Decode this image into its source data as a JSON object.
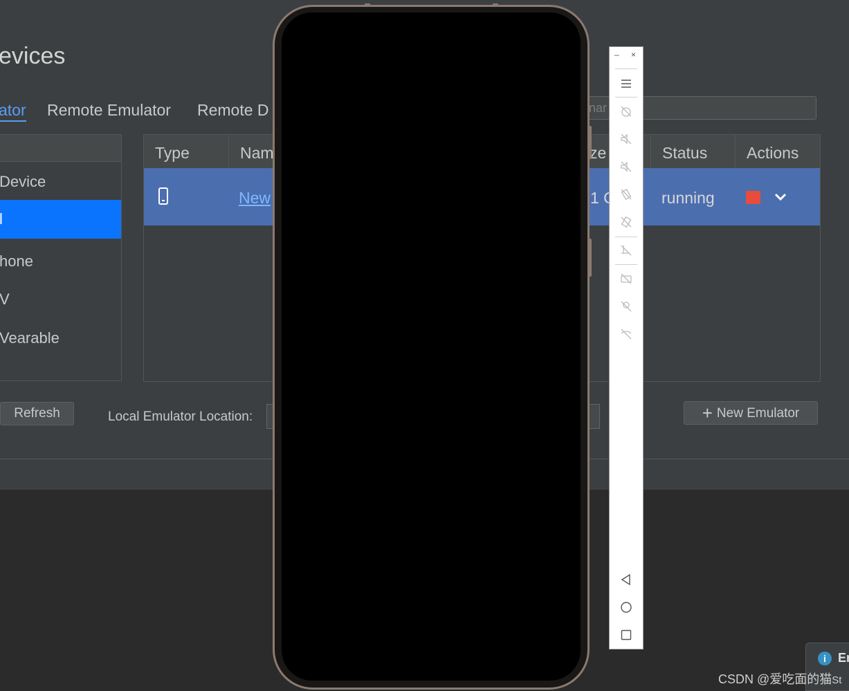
{
  "dialog": {
    "title": "evices",
    "tabs": [
      {
        "label": "ator",
        "active": true
      },
      {
        "label": "Remote Emulator",
        "active": false
      },
      {
        "label": "Remote D",
        "active": false
      }
    ],
    "search_placeholder": "nar"
  },
  "categories": [
    {
      "label": "Device",
      "selected": false
    },
    {
      "label": "l",
      "selected": true
    },
    {
      "label": "hone",
      "selected": false
    },
    {
      "label": "V",
      "selected": false
    },
    {
      "label": "Vearable",
      "selected": false
    }
  ],
  "table": {
    "headers": [
      "Type",
      "Nam",
      "ze",
      "Status",
      "Actions"
    ],
    "row": {
      "type_icon": "phone-icon",
      "name": "New",
      "size": "1 C",
      "status": "running"
    }
  },
  "buttons": {
    "refresh": "Refresh",
    "new_emulator": "New Emulator"
  },
  "location": {
    "label": "Local Emulator Location:"
  },
  "toolbar": {
    "minimize": "–",
    "close": "×"
  },
  "notification": {
    "text": "Er"
  },
  "watermark": "CSDN @爱吃面的猫",
  "watermark_tail": "St",
  "colors": {
    "accent": "#589df6",
    "selected": "#0a74ff",
    "row_highlight": "#4b6eaf",
    "stop": "#e74c3c"
  }
}
